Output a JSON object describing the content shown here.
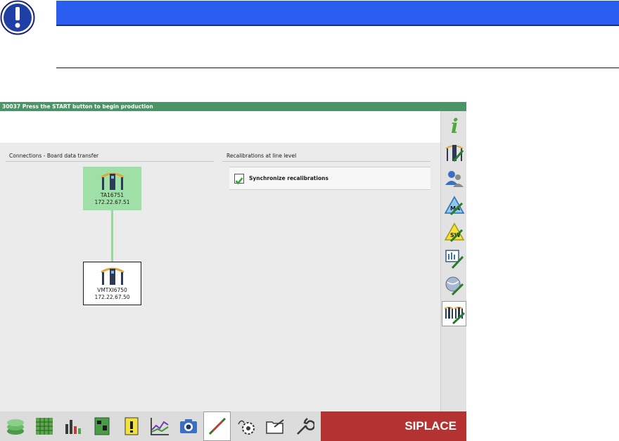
{
  "app": {
    "status_message": "30037 Press the START button to begin production",
    "brand": "SIPLACE"
  },
  "connections": {
    "title": "Connections - Board data transfer",
    "nodes": [
      {
        "name": "TA16751",
        "ip": "172.22.67.51",
        "selected": true
      },
      {
        "name": "VMTXI6750",
        "ip": "172.22.67.50",
        "selected": false
      }
    ]
  },
  "recalibrations": {
    "title": "Recalibrations at line level",
    "option_label": "Synchronize recalibrations",
    "checked": true
  },
  "sidebar": {
    "items": [
      "info-icon",
      "station-edit-icon",
      "users-icon",
      "ma-warning-icon",
      "sw-warning-icon",
      "display-edit-icon",
      "globe-edit-icon",
      "line-edit-icon"
    ],
    "active": "line-edit-icon"
  },
  "toolbar": {
    "items": [
      "production-icon",
      "grid-icon",
      "bar-chart-icon",
      "board-icon",
      "alert-doc-icon",
      "line-chart-icon",
      "camera-icon",
      "tools-icon",
      "hand-gear-icon",
      "folder-icon",
      "wrench-icon"
    ],
    "active": "tools-icon"
  },
  "colors": {
    "status_green": "#4a9466",
    "selected_node": "#9fe0a6",
    "brand_red": "#b43232",
    "notice_blue": "#2a5ef0"
  }
}
